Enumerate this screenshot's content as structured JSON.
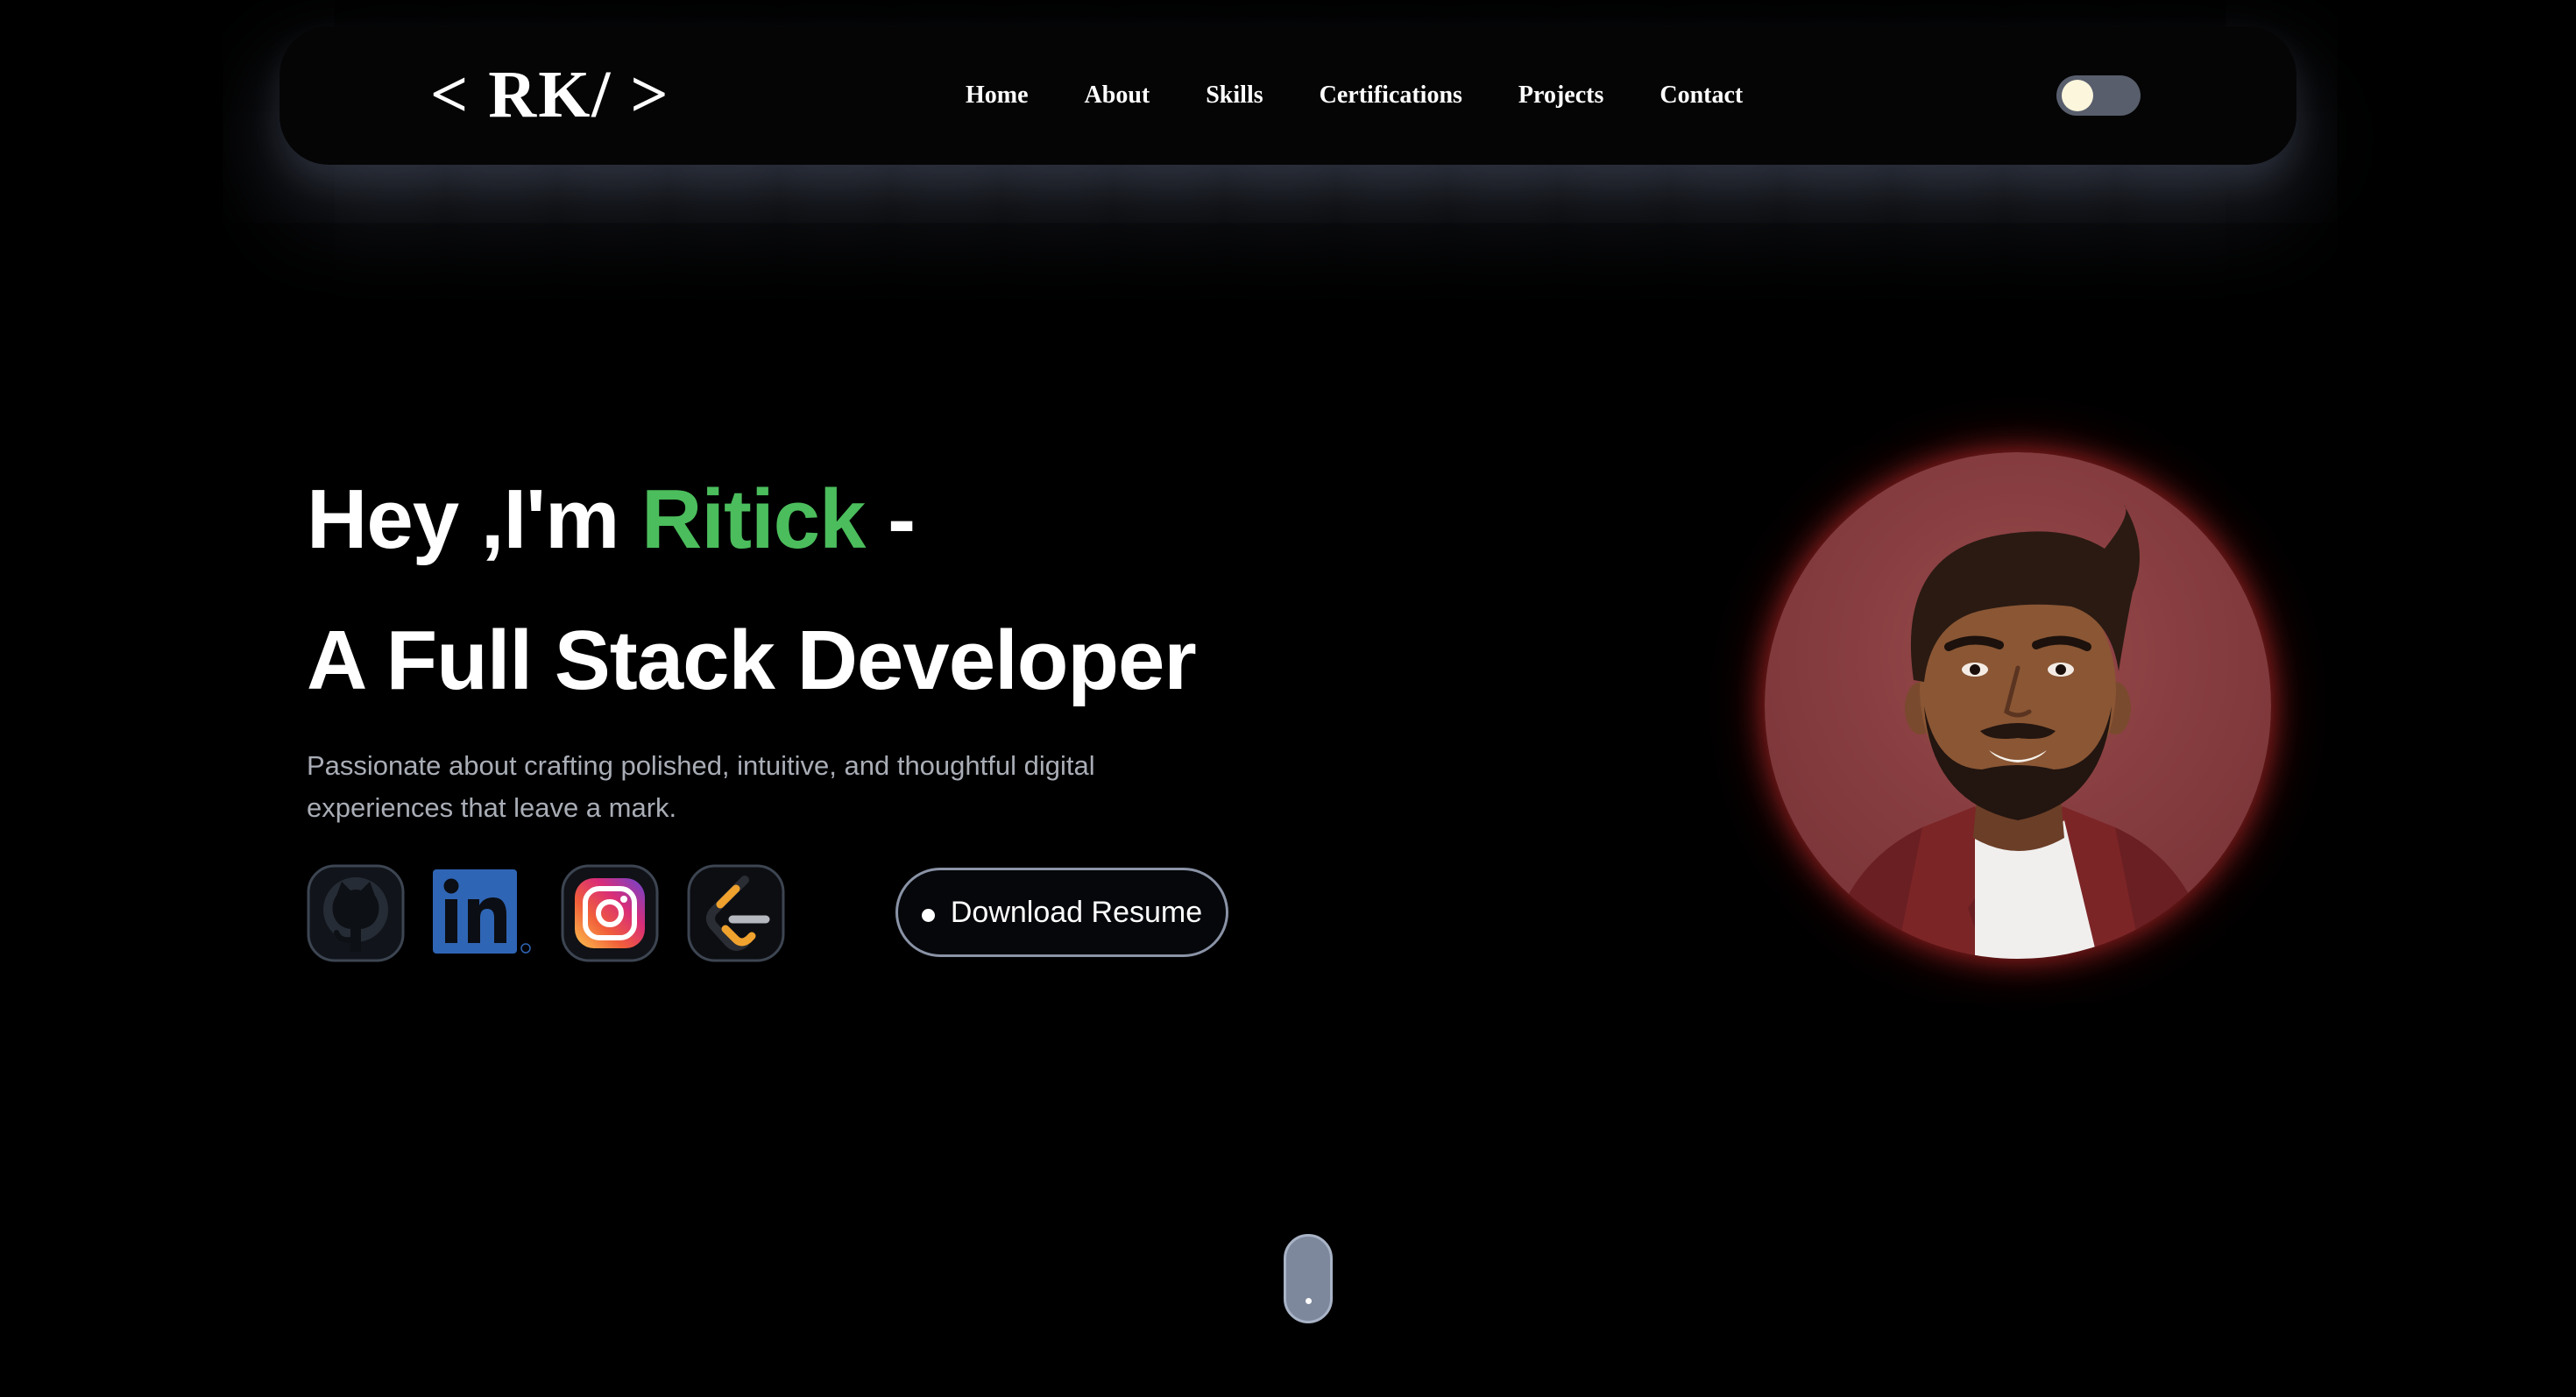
{
  "navbar": {
    "logo": "< RK/ >",
    "links": [
      "Home",
      "About",
      "Skills",
      "Certifications",
      "Projects",
      "Contact"
    ],
    "theme_toggle": {
      "state": "off",
      "knob_color": "#fbf6dc"
    }
  },
  "hero": {
    "greeting_prefix": "Hey ,I'm ",
    "name": "Ritick",
    "greeting_suffix": " -",
    "role": "A Full Stack Developer",
    "description": "Passionate about crafting polished, intuitive, and thoughtful digital experiences that leave a mark.",
    "socials": [
      {
        "name": "github",
        "icon": "github-icon"
      },
      {
        "name": "linkedin",
        "icon": "linkedin-icon"
      },
      {
        "name": "instagram",
        "icon": "instagram-icon"
      },
      {
        "name": "leetcode",
        "icon": "leetcode-icon"
      }
    ],
    "download_button": "Download Resume"
  },
  "profile": {
    "icon": "profile-photo",
    "background_color": "#894043"
  },
  "colors": {
    "background": "#000000",
    "accent_green": "#4bbd5c",
    "description_gray": "#a9adb6",
    "profile_glow": "#c82d2d"
  }
}
